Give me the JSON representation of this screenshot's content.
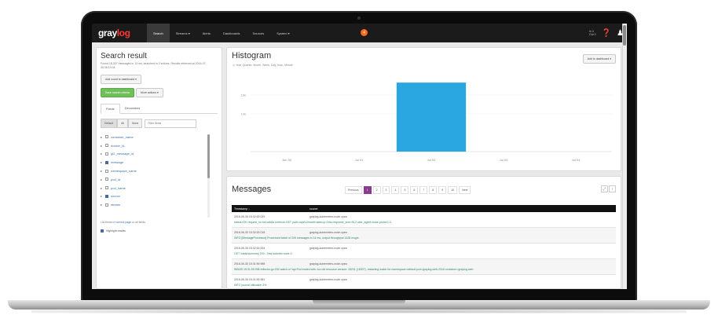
{
  "colors": {
    "brand_red": "#ff3633",
    "navbar_bg": "#1b1b1b",
    "histogram_bar": "#2aa7e0",
    "page_active": "#8a3a8f",
    "message_text_green": "#2e8a58"
  },
  "navbar": {
    "logo_part1": "gray",
    "logo_part2": "log",
    "items": [
      "Search",
      "Streams ▾",
      "Alerts",
      "Dashboards",
      "Sources",
      "System ▾"
    ],
    "badge": "4",
    "stats_line1": "In 0",
    "stats_line2": "Out 0",
    "icons": [
      "help-icon",
      "user-icon"
    ]
  },
  "sidebar": {
    "title": "Search result",
    "meta": "Found 18,307 messages in 13 ms, searched in 2 indices. Results retrieved at 2016-07-06 08:19:04.",
    "add_dashboard_button": "Add count to dashboard ▾",
    "save_search_button": "Save search criteria",
    "more_actions_button": "More actions ▾",
    "tabs": [
      "Fields",
      "Decorators"
    ],
    "filter_buttons": [
      "Default",
      "All",
      "None"
    ],
    "filter_placeholder": "Filter fields",
    "fields": [
      {
        "name": "container_name",
        "checked": false
      },
      {
        "name": "docker_id",
        "checked": false
      },
      {
        "name": "gl2_message_id",
        "checked": false
      },
      {
        "name": "message",
        "checked": true
      },
      {
        "name": "namespace_name",
        "checked": false
      },
      {
        "name": "pod_id",
        "checked": false
      },
      {
        "name": "pod_name",
        "checked": false
      },
      {
        "name": "source",
        "checked": true
      },
      {
        "name": "stream",
        "checked": false
      }
    ],
    "footer_prefix": "List fields of ",
    "footer_link": "current page",
    "footer_suffix": " or all fields.",
    "highlight_label": "Highlight results"
  },
  "histogram": {
    "title": "Histogram",
    "resolution_label": "Year, Quarter, Month, Week, Day, Hour, Minute",
    "add_dashboard_button": "Add to dashboard ▾",
    "x_ticks": [
      "Jun 30",
      "Jul 01",
      "Jul 02",
      "Jul 03",
      "Jul 04"
    ],
    "y_ticks": [
      "15k",
      "10k"
    ]
  },
  "chart_data": {
    "type": "bar",
    "x": [
      "Jul 02"
    ],
    "values": [
      18307
    ],
    "ylim": [
      0,
      20000
    ],
    "grid": true
  },
  "messages": {
    "title": "Messages",
    "pager": [
      "Previous",
      "1",
      "2",
      "3",
      "4",
      "5",
      "6",
      "7",
      "8",
      "9",
      "10",
      "Next"
    ],
    "active_page": "1",
    "columns": [
      "Timestamp ↓",
      "source"
    ],
    "rows": [
      {
        "timestamp": "2016-06-30 15:32:00.029",
        "source": "graylog-kubernetes-node-xyzw",
        "message": "status=OK request_id=4e1cdb8a method=GET path=/api/v1/health latency=2ms response_size=512 user_agent=kube-probe/1.3"
      },
      {
        "timestamp": "2016-06-30 15:32:00.018",
        "source": "graylog-kubernetes-node-xyzw",
        "message": "INFO [MessageProcessor] Processed batch of 200 messages in 14 ms, output throughput 1428 msg/s"
      },
      {
        "timestamp": "2016-06-30 15:32:00.004",
        "source": "graylog-kubernetes-node-xyzw",
        "message": "GET /stats/summary 200 - 3ms kubelet=node-3"
      },
      {
        "timestamp": "2016-06-30 15:31:59.998",
        "source": "graylog-kubernetes-node-xyzw",
        "message": "W0630 15:31:59.998 reflector.go:334 watch of *api.Pod ended with: too old resource version: 18231 (18307), restarting watch for namespace=default pod=graylog-web-2316 container=graylog-web"
      },
      {
        "timestamp": "2016-06-30 15:31:59.981",
        "source": "graylog-kubernetes-node-xyzw",
        "message": "INFO journal utilization 3%"
      }
    ]
  }
}
